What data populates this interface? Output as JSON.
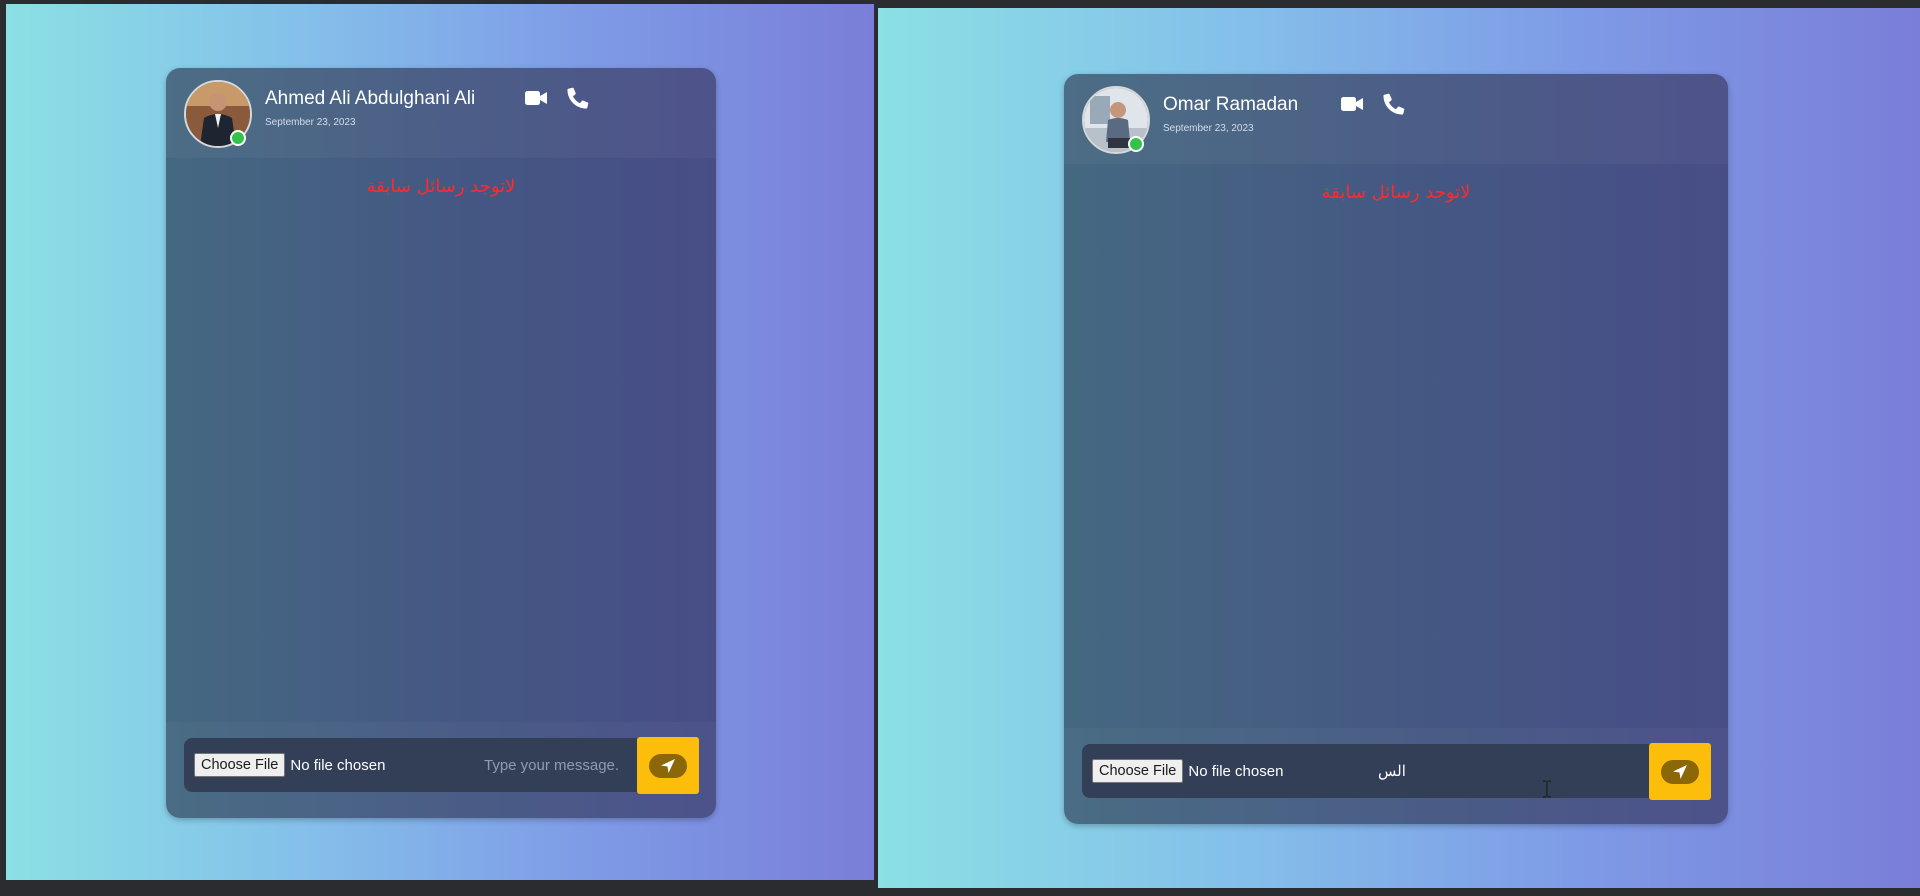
{
  "windows": [
    {
      "id": "left",
      "contact": {
        "name": "Ahmed Ali Abdulghani Ali",
        "last_seen": "September 23, 2023",
        "online": true
      },
      "header_actions": {
        "video_icon": "video-camera-icon",
        "call_icon": "phone-icon"
      },
      "messages_area": {
        "empty_text": "لاتوجد رسائل سابقة"
      },
      "composer": {
        "choose_file_label": "Choose File",
        "file_status": "No file chosen",
        "message_value": "",
        "message_placeholder": "Type your message.",
        "send_icon": "send-icon"
      }
    },
    {
      "id": "right",
      "contact": {
        "name": "Omar Ramadan",
        "last_seen": "September 23, 2023",
        "online": true
      },
      "header_actions": {
        "video_icon": "video-camera-icon",
        "call_icon": "phone-icon"
      },
      "messages_area": {
        "empty_text": "لاتوجد رسائل سابقة"
      },
      "composer": {
        "choose_file_label": "Choose File",
        "file_status": "No file chosen",
        "message_value": "الس",
        "message_placeholder": "Type your message.",
        "send_icon": "send-icon"
      }
    }
  ],
  "colors": {
    "accent_send": "#fdbd0b",
    "online_indicator": "#35c248",
    "empty_notice": "#ff2a2a",
    "background_gradient_start": "#8be0e4",
    "background_gradient_end": "#7a7ed8"
  }
}
